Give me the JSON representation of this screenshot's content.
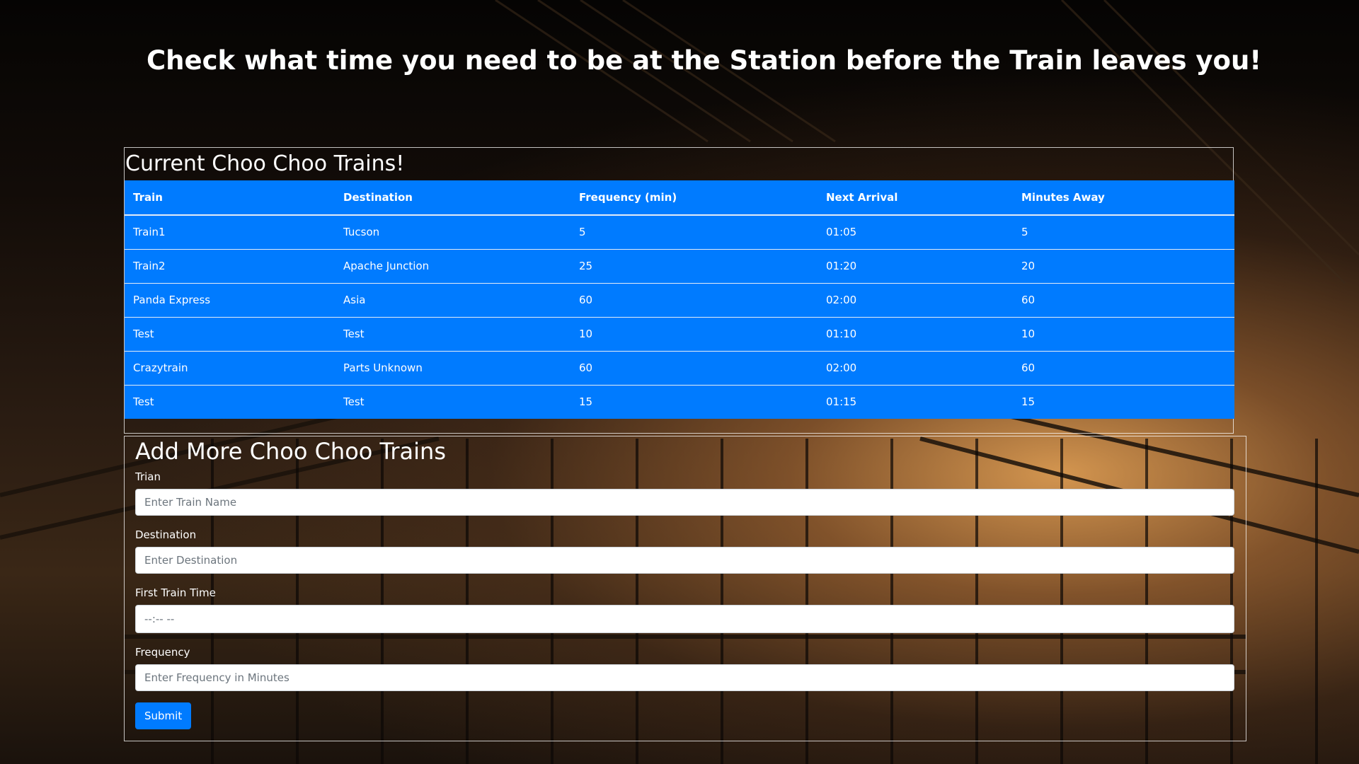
{
  "page": {
    "title": "Check what time you need to be at the Station before the Train leaves you!"
  },
  "trains_panel": {
    "heading": "Current Choo Choo Trains!",
    "columns": [
      "Train",
      "Destination",
      "Frequency (min)",
      "Next Arrival",
      "Minutes Away"
    ],
    "rows": [
      [
        "Train1",
        "Tucson",
        "5",
        "01:05",
        "5"
      ],
      [
        "Train2",
        "Apache Junction",
        "25",
        "01:20",
        "20"
      ],
      [
        "Panda Express",
        "Asia",
        "60",
        "02:00",
        "60"
      ],
      [
        "Test",
        "Test",
        "10",
        "01:10",
        "10"
      ],
      [
        "Crazytrain",
        "Parts Unknown",
        "60",
        "02:00",
        "60"
      ],
      [
        "Test",
        "Test",
        "15",
        "01:15",
        "15"
      ]
    ]
  },
  "form": {
    "heading": "Add More Choo Choo Trains",
    "train_label": "Trian",
    "train_placeholder": "Enter Train Name",
    "destination_label": "Destination",
    "destination_placeholder": "Enter Destination",
    "first_time_label": "First Train Time",
    "first_time_value": "--:-- --",
    "frequency_label": "Frequency",
    "frequency_placeholder": "Enter Frequency in Minutes",
    "submit_label": "Submit"
  },
  "colors": {
    "accent": "#007bff",
    "text": "#ffffff",
    "input_bg": "#ffffff"
  }
}
